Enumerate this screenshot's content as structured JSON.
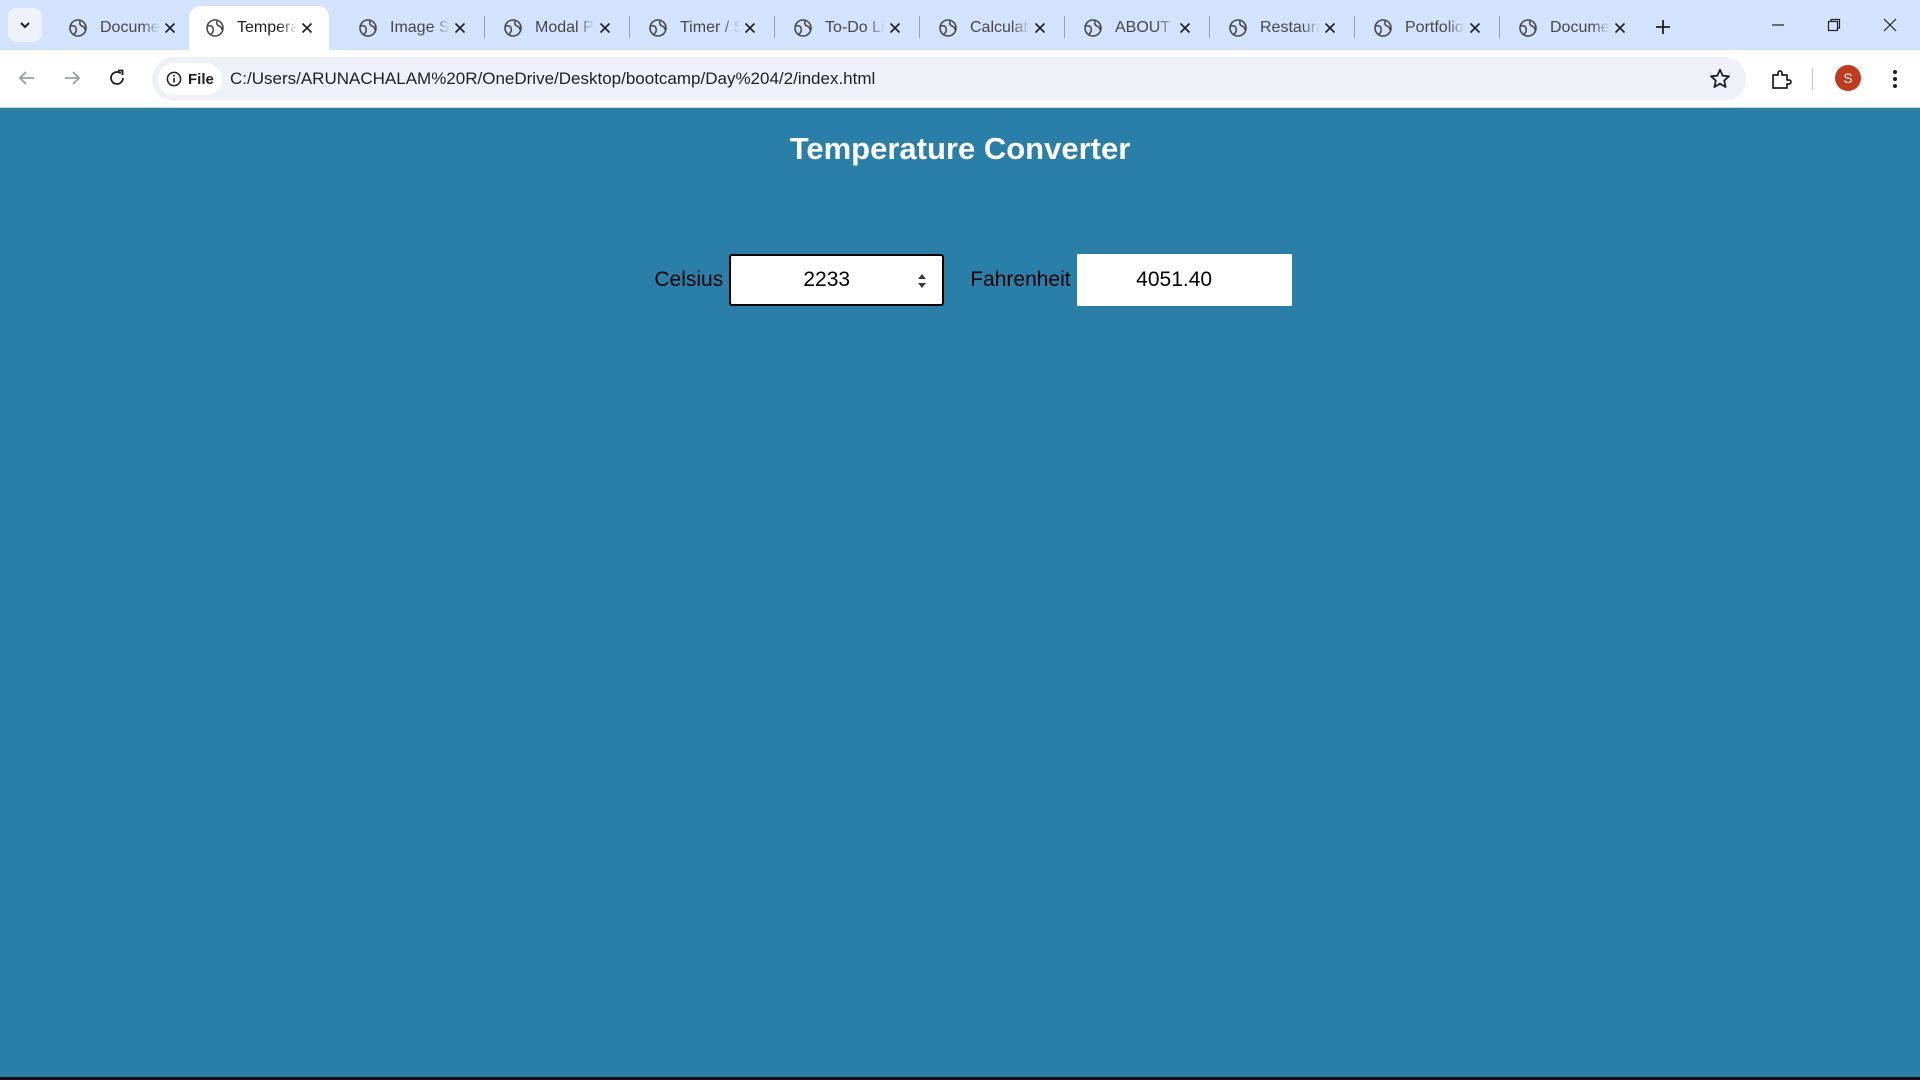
{
  "browser": {
    "tabs": [
      {
        "title": "Document",
        "active": false
      },
      {
        "title": "Temperature Converter",
        "active": true
      },
      {
        "title": "Image Slider",
        "active": false
      },
      {
        "title": "Modal Popup",
        "active": false
      },
      {
        "title": "Timer / Stopwatch",
        "active": false
      },
      {
        "title": "To-Do List",
        "active": false
      },
      {
        "title": "Calculator",
        "active": false
      },
      {
        "title": "ABOUT ME",
        "active": false
      },
      {
        "title": "Restaurant",
        "active": false
      },
      {
        "title": "Portfolio",
        "active": false
      },
      {
        "title": "Document",
        "active": false
      }
    ],
    "site_chip": "File",
    "url": "C:/Users/ARUNACHALAM%20R/OneDrive/Desktop/bootcamp/Day%204/2/index.html",
    "profile_initial": "S"
  },
  "page": {
    "title": "Temperature Converter",
    "celsius_label": "Celsius",
    "celsius_value": "2233",
    "fahrenheit_label": "Fahrenheit",
    "fahrenheit_value": "4051.40"
  },
  "colors": {
    "page_background": "#2a7fa8",
    "tab_strip": "#d3e3fd",
    "avatar": "#c13a1e"
  }
}
